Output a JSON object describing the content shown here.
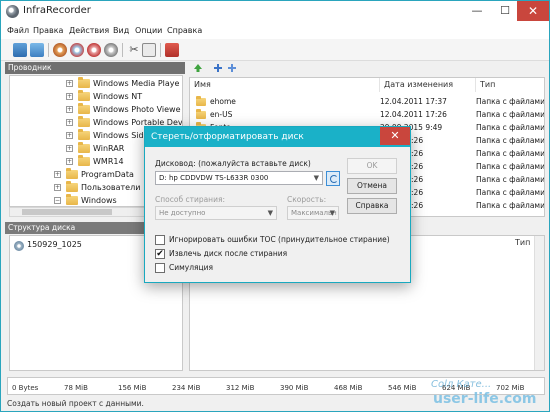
{
  "window": {
    "title": "InfraRecorder",
    "min_glyph": "—",
    "max_glyph": "☐",
    "close_glyph": "✕"
  },
  "menu": {
    "items": [
      "Файл",
      "Правка",
      "Действия",
      "Вид",
      "Опции",
      "Справка"
    ]
  },
  "toolbar": {
    "icons": [
      "new-project-icon",
      "open-project-icon",
      "burn-disc-icon",
      "copy-disc-icon",
      "erase-disc-icon",
      "disc-info-icon",
      "cut-icon",
      "properties-icon",
      "exit-icon"
    ]
  },
  "explorer": {
    "header": "Проводник",
    "tree": [
      {
        "label": "Windows Media Playe",
        "expander": "+"
      },
      {
        "label": "Windows NT",
        "expander": "+"
      },
      {
        "label": "Windows Photo Viewe",
        "expander": "+"
      },
      {
        "label": "Windows Portable Dev",
        "expander": "+"
      },
      {
        "label": "Windows Side",
        "expander": "+"
      },
      {
        "label": "WinRAR",
        "expander": "+"
      },
      {
        "label": "WMR14",
        "expander": "+"
      },
      {
        "label": "ProgramData",
        "expander": "+"
      },
      {
        "label": "Пользователи",
        "expander": "+"
      },
      {
        "label": "Windows",
        "expander": "−"
      }
    ]
  },
  "filelist": {
    "columns": [
      "Имя",
      "Дата изменения",
      "Тип"
    ],
    "rows": [
      {
        "name": "ehome",
        "date": "12.04.2011 17:37",
        "type": "Папка с файлами"
      },
      {
        "name": "en-US",
        "date": "12.04.2011 17:26",
        "type": "Папка с файлами"
      },
      {
        "name": "Fonts",
        "date": "29.09.2015 9:49",
        "type": "Папка с файлами"
      },
      {
        "name": "",
        "date": "2011 17:26",
        "type": "Папка с файлами"
      },
      {
        "name": "",
        "date": "2011 17:26",
        "type": "Папка с файлами"
      },
      {
        "name": "",
        "date": "2011 17:26",
        "type": "Папка с файлами"
      },
      {
        "name": "",
        "date": "2011 17:26",
        "type": "Папка с файлами"
      },
      {
        "name": "",
        "date": "2011 17:26",
        "type": "Папка с файлами"
      },
      {
        "name": "",
        "date": "2011 17:26",
        "type": "Папка с файлами"
      },
      {
        "name": "",
        "date": "2011 17:26",
        "type": "Папка с файлами"
      }
    ]
  },
  "disc_structure": {
    "header": "Структура диска",
    "root_label": "150929_1025",
    "type_column": "Тип"
  },
  "capacity": {
    "used_fraction": 0.0,
    "ticks": [
      "0 Bytes",
      "78 MiB",
      "156 MiB",
      "234 MiB",
      "312 MiB",
      "390 MiB",
      "468 MiB",
      "546 MiB",
      "624 MiB",
      "702 MiB"
    ]
  },
  "status": {
    "text": "Создать новый проект с данными."
  },
  "dialog": {
    "title": "Стереть/отформатировать диск",
    "close_glyph": "✕",
    "drive_label": "Дисковод: (пожалуйста вставьте диск)",
    "drive_value": "D: hp CDDVDW TS-L633R 0300",
    "method_label": "Способ стирания:",
    "method_value": "Не доступно",
    "speed_label": "Скорость:",
    "speed_value": "Максимальн",
    "ok_label": "OK",
    "cancel_label": "Отмена",
    "help_label": "Справка",
    "options": [
      {
        "label": "Игнорировать ошибки TOC (принудительное стирание)",
        "checked": false
      },
      {
        "label": "Извлечь диск после стирания",
        "checked": true
      },
      {
        "label": "Симуляция",
        "checked": false
      }
    ]
  },
  "watermark": {
    "line1": "Соlл Кате...",
    "line2": "user-life.com"
  },
  "colors": {
    "dialog_accent": "#1ab1c8",
    "close_red": "#c9463d",
    "folder_yellow": "#e8b649"
  }
}
